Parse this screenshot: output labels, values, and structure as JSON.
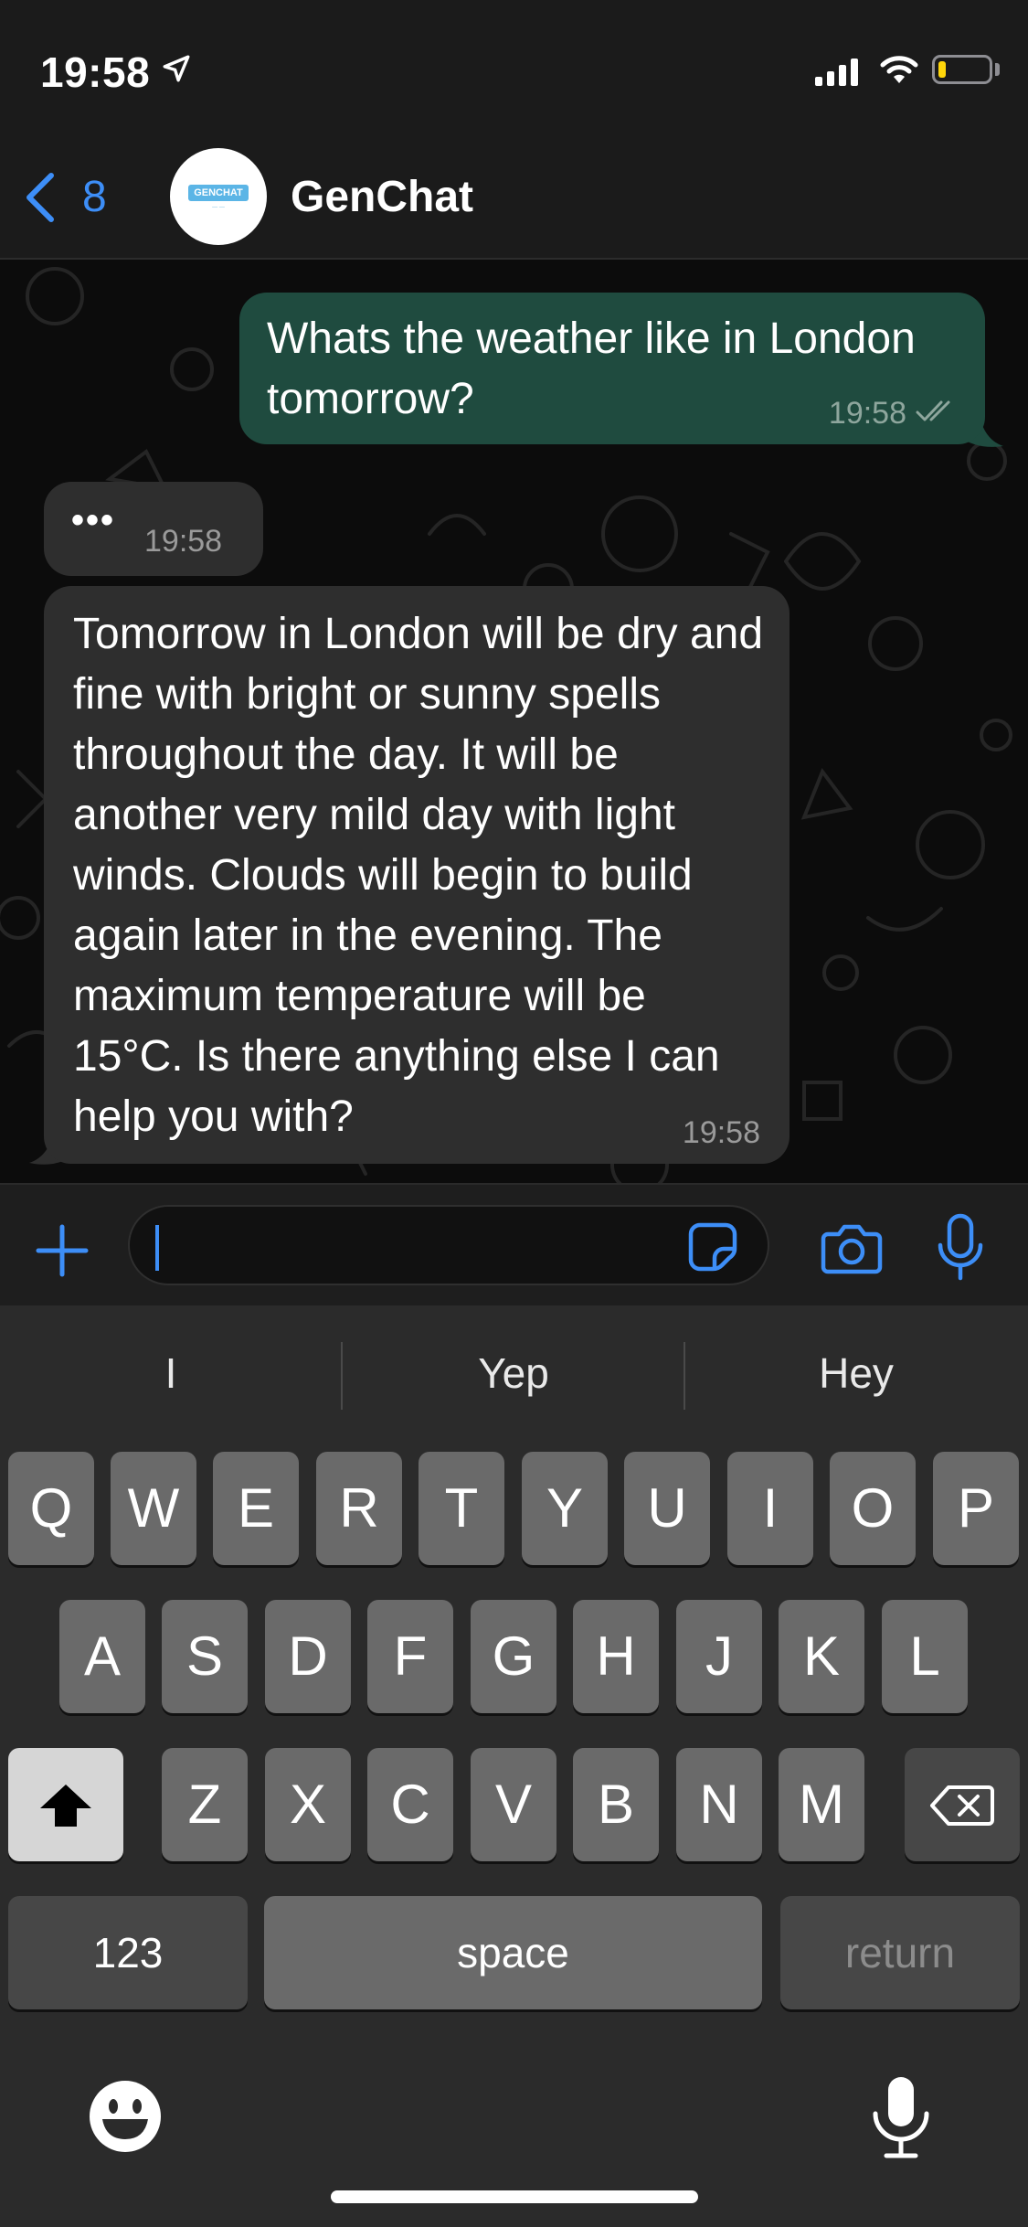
{
  "status_bar": {
    "time": "19:58",
    "battery_level": 0.15
  },
  "header": {
    "back_count": "8",
    "contact_name": "GenChat",
    "avatar_logo_text": "GENCHAT"
  },
  "messages": [
    {
      "direction": "outgoing",
      "text": "Whats the weather like in London tomorrow?",
      "time": "19:58",
      "status": "read"
    },
    {
      "direction": "incoming",
      "text": "•••",
      "time": "19:58"
    },
    {
      "direction": "incoming",
      "text": "Tomorrow in London will be dry and fine with bright or sunny spells throughout the day. It will be another very mild day with light winds. Clouds will begin to build again later in the evening. The maximum temperature will be 15°C. Is there anything else I can help you with?",
      "time": "19:58"
    }
  ],
  "composer": {
    "value": ""
  },
  "keyboard": {
    "suggestions": [
      "I",
      "Yep",
      "Hey"
    ],
    "row1": [
      "Q",
      "W",
      "E",
      "R",
      "T",
      "Y",
      "U",
      "I",
      "O",
      "P"
    ],
    "row2": [
      "A",
      "S",
      "D",
      "F",
      "G",
      "H",
      "J",
      "K",
      "L"
    ],
    "row3": [
      "Z",
      "X",
      "C",
      "V",
      "B",
      "N",
      "M"
    ],
    "numbers_label": "123",
    "space_label": "space",
    "return_label": "return"
  },
  "colors": {
    "accent": "#3d8ef7",
    "outgoing_bubble": "#1f4b3f",
    "incoming_bubble": "#2e2e2e"
  }
}
